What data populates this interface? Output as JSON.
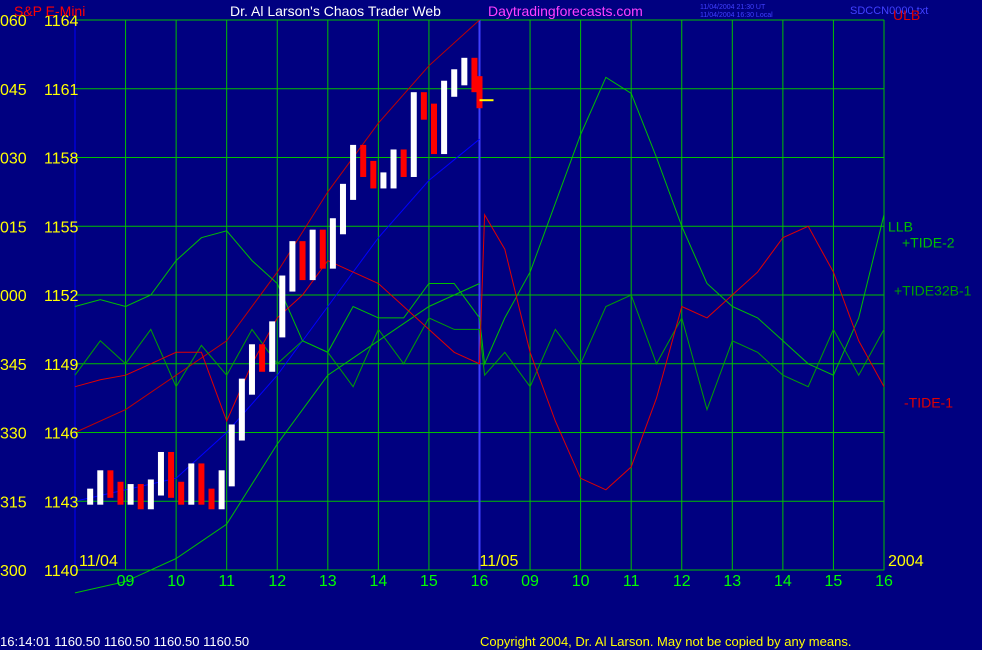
{
  "header": {
    "symbol": "S&P E-Mini",
    "title": "Dr. Al Larson's Chaos Trader Web",
    "site": "Daytradingforecasts.com",
    "stamp_ut": "11/04/2004 21:30 UT",
    "stamp_local": "11/04/2004 16:30 Local",
    "chart_id": "SDCCN0000.txt",
    "ulb_label": "ULB"
  },
  "footer": {
    "quote": "16:14:01  1160.50 1160.50 1160.50 1160.50",
    "copyright": "Copyright 2004, Dr. Al Larson. May not be copied by any means."
  },
  "colors": {
    "background": "#000080",
    "grid": "#00C000",
    "price_up": "#FFFFFF",
    "price_down": "#FF0000",
    "price_line": "#FFFF00",
    "tide_green": "#00C000",
    "tide_red": "#E00000",
    "bands": "#0000FF",
    "axis_text": "#FFFF00",
    "time_text": "#00FF00"
  },
  "chart_data": {
    "type": "line",
    "y_tick_labels": [
      {
        "left": "060",
        "right": "1164"
      },
      {
        "left": "045",
        "right": "1161"
      },
      {
        "left": "030",
        "right": "1158"
      },
      {
        "left": "015",
        "right": "1155"
      },
      {
        "left": "000",
        "right": "1152"
      },
      {
        "left": "345",
        "right": "1149"
      },
      {
        "left": "330",
        "right": "1146"
      },
      {
        "left": "315",
        "right": "1143"
      },
      {
        "left": "300",
        "right": "1140"
      }
    ],
    "ylim": [
      1140,
      1164
    ],
    "x_tick_labels": [
      "09",
      "10",
      "11",
      "12",
      "13",
      "14",
      "15",
      "16",
      "09",
      "10",
      "11",
      "12",
      "13",
      "14",
      "15",
      "16"
    ],
    "date_labels": [
      "11/04",
      "11/05"
    ],
    "year_label": "2004",
    "last_price": 1160.5,
    "grid": true,
    "series": [
      {
        "name": "+TIDE-2",
        "color": "#00C000"
      },
      {
        "name": "+TIDE32B-1",
        "color": "#00A000"
      },
      {
        "name": "-TIDE-1",
        "color": "#E00000"
      },
      {
        "name": "LLB",
        "color": "#00C000"
      }
    ],
    "price_bars": {
      "x_hours": [
        8.3,
        8.5,
        8.7,
        8.9,
        9.1,
        9.3,
        9.5,
        9.7,
        9.9,
        10.1,
        10.3,
        10.5,
        10.7,
        10.9,
        11.1,
        11.3,
        11.5,
        11.7,
        11.9,
        12.1,
        12.3,
        12.5,
        12.7,
        12.9,
        13.1,
        13.3,
        13.5,
        13.7,
        13.9,
        14.1,
        14.3,
        14.5,
        14.7,
        14.9,
        15.1,
        15.3,
        15.5,
        15.7,
        15.9,
        16.0
      ],
      "close": [
        1143.2,
        1144.0,
        1143.5,
        1143.2,
        1143.4,
        1143.0,
        1143.6,
        1144.8,
        1143.5,
        1143.2,
        1144.3,
        1143.2,
        1143.0,
        1144.0,
        1146.0,
        1148.0,
        1149.5,
        1149.0,
        1150.5,
        1152.5,
        1154.0,
        1153.0,
        1154.5,
        1153.5,
        1155.0,
        1156.5,
        1158.2,
        1157.5,
        1157.0,
        1157.0,
        1158.0,
        1157.5,
        1160.5,
        1160.0,
        1158.5,
        1161.0,
        1161.5,
        1162.0,
        1161.2,
        1160.5
      ]
    },
    "tide2_forecast": {
      "x_hours": [
        8.0,
        8.5,
        9.0,
        9.5,
        10.0,
        10.5,
        11.0,
        11.5,
        12.0,
        12.5,
        13.0,
        13.5,
        14.0,
        14.5,
        15.0,
        15.5,
        16.0,
        16.1,
        16.5,
        17.0,
        17.5,
        18.0,
        18.5,
        19.0,
        19.5,
        20.0,
        20.5,
        21.0,
        21.5,
        22.0,
        22.5,
        23.0,
        23.5,
        24.0
      ],
      "y": [
        1151.5,
        1151.8,
        1151.5,
        1152.0,
        1153.5,
        1154.5,
        1154.8,
        1153.5,
        1152.5,
        1150.0,
        1149.5,
        1151.5,
        1151.0,
        1151.0,
        1152.5,
        1152.5,
        1151.0,
        1149.0,
        1151.0,
        1153.0,
        1156.0,
        1159.0,
        1161.5,
        1160.8,
        1158.0,
        1155.0,
        1152.5,
        1151.5,
        1151.0,
        1150.0,
        1149.0,
        1148.5,
        1151.0,
        1155.5
      ]
    },
    "tide1_forecast": {
      "x_hours": [
        8.0,
        8.5,
        9.0,
        9.5,
        10.0,
        10.5,
        11.0,
        11.5,
        12.0,
        12.5,
        13.0,
        13.5,
        14.0,
        14.5,
        15.0,
        15.5,
        16.0,
        16.1,
        16.5,
        17.0,
        17.5,
        18.0,
        18.5,
        19.0,
        19.5,
        20.0,
        20.5,
        21.0,
        21.5,
        22.0,
        22.5,
        23.0,
        23.5,
        24.0
      ],
      "y": [
        1148.0,
        1148.3,
        1148.5,
        1149.0,
        1149.5,
        1149.5,
        1146.5,
        1149.0,
        1151.0,
        1152.0,
        1153.5,
        1153.0,
        1152.5,
        1151.5,
        1150.5,
        1149.5,
        1149.0,
        1155.5,
        1154.0,
        1149.5,
        1146.5,
        1144.0,
        1143.5,
        1144.5,
        1147.5,
        1151.5,
        1151.0,
        1152.0,
        1153.0,
        1154.5,
        1155.0,
        1153.0,
        1150.0,
        1148.0
      ]
    },
    "tide32_forecast": {
      "x_hours": [
        8.0,
        8.5,
        9.0,
        9.5,
        10.0,
        10.5,
        11.0,
        11.5,
        12.0,
        12.5,
        13.0,
        13.5,
        14.0,
        14.5,
        15.0,
        15.5,
        16.0,
        16.1,
        16.5,
        17.0,
        17.5,
        18.0,
        18.5,
        19.0,
        19.5,
        20.0,
        20.5,
        21.0,
        21.5,
        22.0,
        22.5,
        23.0,
        23.5,
        24.0
      ],
      "y": [
        1148.5,
        1150.0,
        1149.0,
        1150.5,
        1148.0,
        1149.8,
        1148.5,
        1150.5,
        1149.0,
        1150.0,
        1149.5,
        1148.0,
        1150.5,
        1149.0,
        1151.0,
        1150.5,
        1150.5,
        1148.5,
        1149.5,
        1148.0,
        1150.5,
        1149.0,
        1151.5,
        1152.0,
        1149.0,
        1151.0,
        1147.0,
        1150.0,
        1149.5,
        1148.5,
        1148.0,
        1150.5,
        1148.5,
        1150.5
      ]
    },
    "llb_curve": {
      "x_hours": [
        8.0,
        9.0,
        10.0,
        11.0,
        12.0,
        13.0,
        14.0,
        15.0,
        16.0
      ],
      "y": [
        1139.0,
        1139.5,
        1140.5,
        1142.0,
        1145.5,
        1148.5,
        1150.0,
        1151.5,
        1152.5
      ]
    },
    "upper_band": {
      "x_hours": [
        8.0,
        9.0,
        10.0,
        11.0,
        12.0,
        13.0,
        14.0,
        15.0,
        16.0
      ],
      "y": [
        1146.0,
        1147.0,
        1148.5,
        1150.0,
        1153.0,
        1156.5,
        1159.5,
        1162.0,
        1164.0
      ]
    },
    "mid_line": {
      "x_hours": [
        8.0,
        9.0,
        10.0,
        11.0,
        12.0,
        13.0,
        14.0,
        15.0,
        16.0
      ],
      "y": [
        1143.0,
        1143.5,
        1144.0,
        1146.0,
        1148.5,
        1151.5,
        1154.5,
        1157.0,
        1158.8
      ]
    }
  }
}
